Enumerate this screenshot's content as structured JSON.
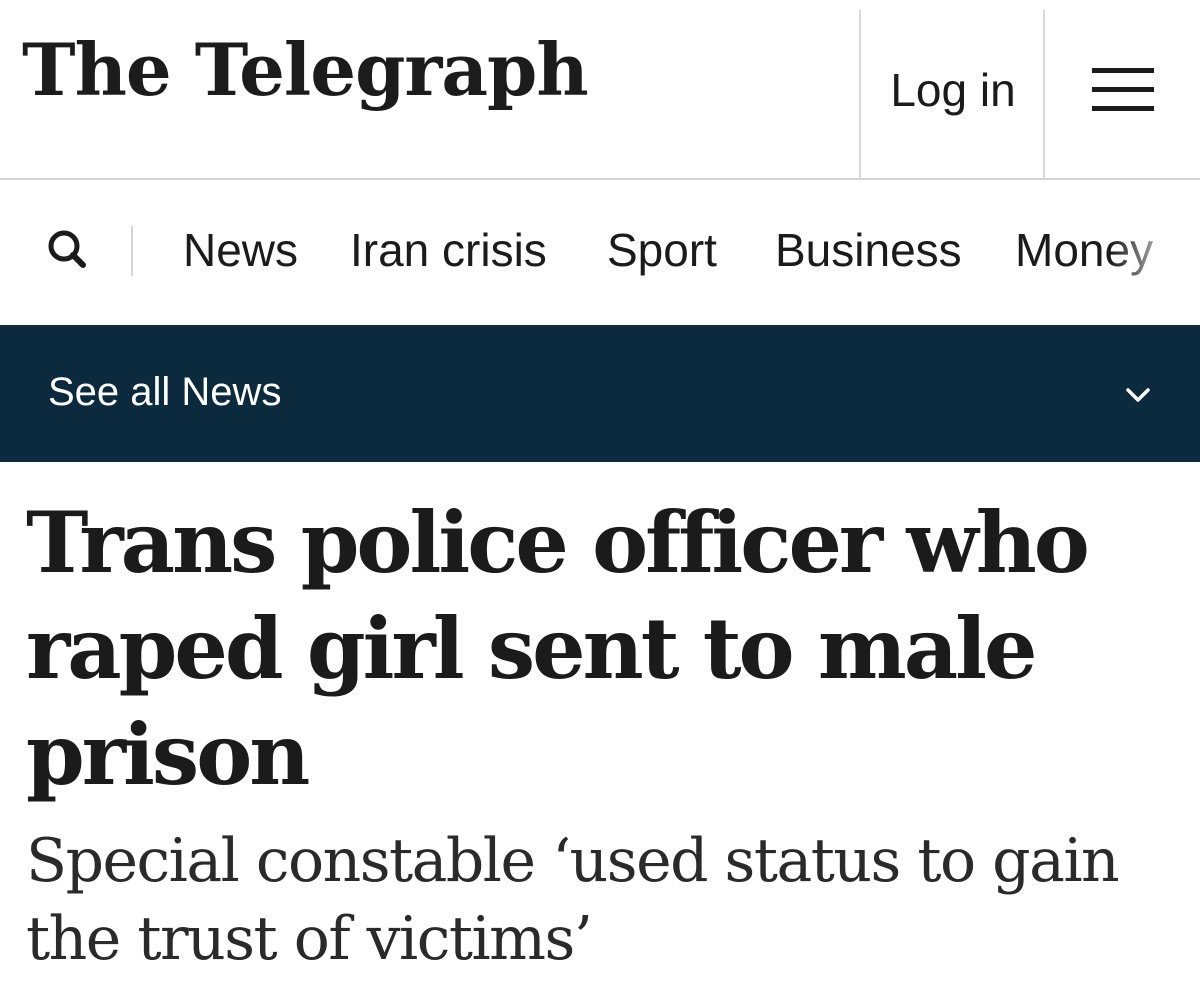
{
  "header": {
    "logo_text": "The Telegraph",
    "login_label": "Log in",
    "menu_icon": "hamburger-menu-icon"
  },
  "nav": {
    "search_icon": "search-icon",
    "items": [
      {
        "label": "News"
      },
      {
        "label": "Iran crisis"
      },
      {
        "label": "Sport"
      },
      {
        "label": "Business"
      },
      {
        "label": "Money"
      }
    ]
  },
  "section_bar": {
    "label": "See all News",
    "icon": "chevron-down-icon",
    "background_color": "#0b2a3d"
  },
  "article": {
    "headline": "Trans police officer who raped girl sent to male prison",
    "standfirst": "Special constable ‘used status to gain the trust of victims’"
  }
}
